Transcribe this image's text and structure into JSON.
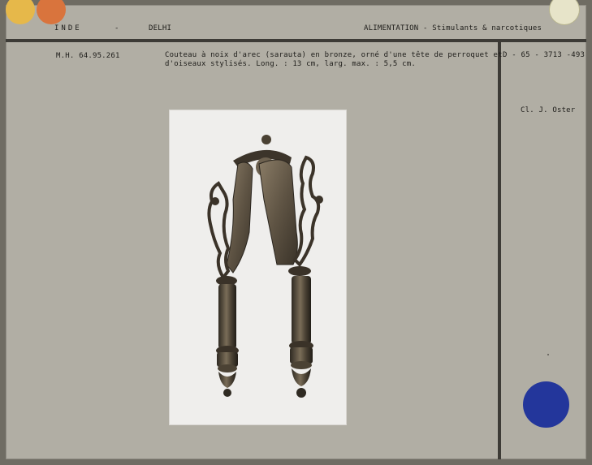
{
  "header": {
    "country": "INDE",
    "dash": "-",
    "city": "DELHI",
    "category": "ALIMENTATION - Stimulants & narcotiques"
  },
  "record": {
    "inventory": "M.H. 64.95.261",
    "description_line1": "Couteau à noix d'arec (sarauta) en bronze, orné d'une tête de perroquet et",
    "description_line2": "d'oiseaux stylisés. Long. : 13 cm, larg. max. : 5,5 cm.",
    "reference": "D - 65 - 3713 -493",
    "credit": "Cl. J. Oster"
  },
  "colors": {
    "card": "#b1aea4",
    "rule": "#3d3b36",
    "dot_yellow": "#e6b84a",
    "dot_orange": "#d9743d",
    "dot_cream": "#e7e4c9",
    "dot_blue": "#23369b"
  },
  "photo": {
    "subject_icon": "betel-nut-cutter-photo"
  }
}
